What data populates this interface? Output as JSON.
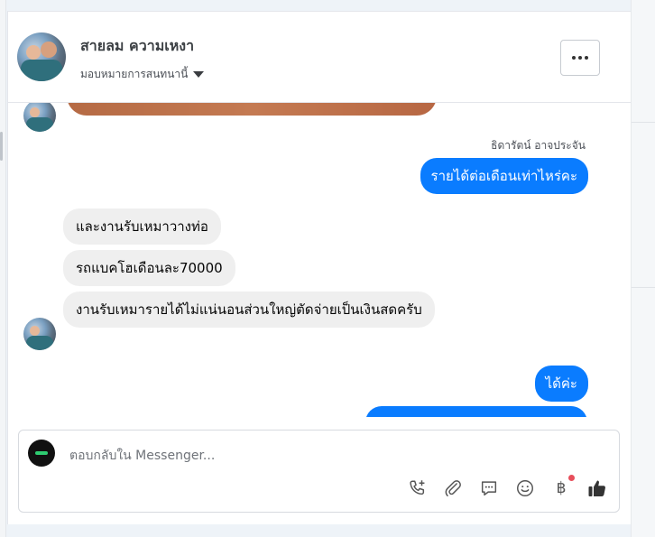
{
  "header": {
    "contact_name": "สายลม ความเหงา",
    "assign_label": "มอบหมายการสนทนานี้",
    "more_label": "..."
  },
  "messages": {
    "sender_name": "ธิดารัตน์ อาจประจัน",
    "items": [
      {
        "direction": "outgoing",
        "text": "รายได้ต่อเดือนเท่าไหร่คะ"
      },
      {
        "direction": "incoming",
        "text": "และงานรับเหมาวางท่อ"
      },
      {
        "direction": "incoming",
        "text": "รถแบคโฮเดือนละ70000"
      },
      {
        "direction": "incoming",
        "text": "งานรับเหมารายได้ไม่แน่นอนส่วนใหญ่ตัดจ่ายเป็นเงินสดครับ"
      },
      {
        "direction": "outgoing",
        "text": "ได้ค่ะ"
      }
    ]
  },
  "composer": {
    "placeholder": "ตอบกลับใน Messenger...",
    "tools": [
      "add-call-icon",
      "attachment-icon",
      "saved-reply-icon",
      "emoji-icon",
      "baht-payment-icon",
      "like-icon"
    ],
    "currency_symbol": "฿"
  },
  "colors": {
    "outgoing_bubble": "#0a7cff",
    "incoming_bubble": "#efefef",
    "notification_dot": "#e74e5b"
  }
}
